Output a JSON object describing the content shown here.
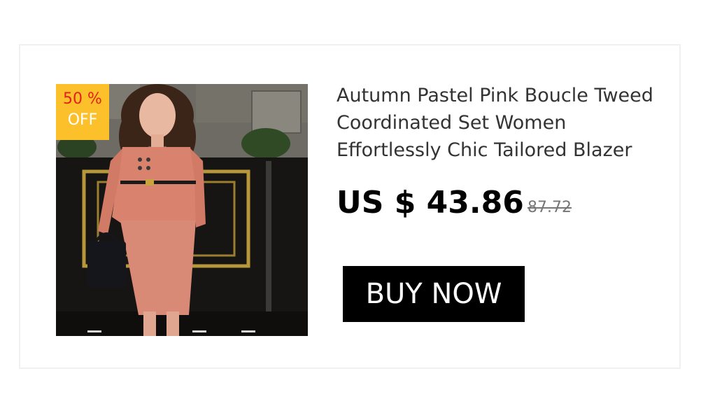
{
  "product": {
    "title": "Autumn Pastel Pink Boucle Tweed Coordinated Set Women Effortlessly Chic Tailored Blazer",
    "price": "US $ 43.86",
    "original_price": "87.72",
    "image_icon": "product-photo"
  },
  "badge": {
    "percent": "50 %",
    "off": "OFF",
    "background_color": "#fbc02a",
    "percent_color": "#e2231a"
  },
  "actions": {
    "buy_label": "BUY NOW"
  }
}
